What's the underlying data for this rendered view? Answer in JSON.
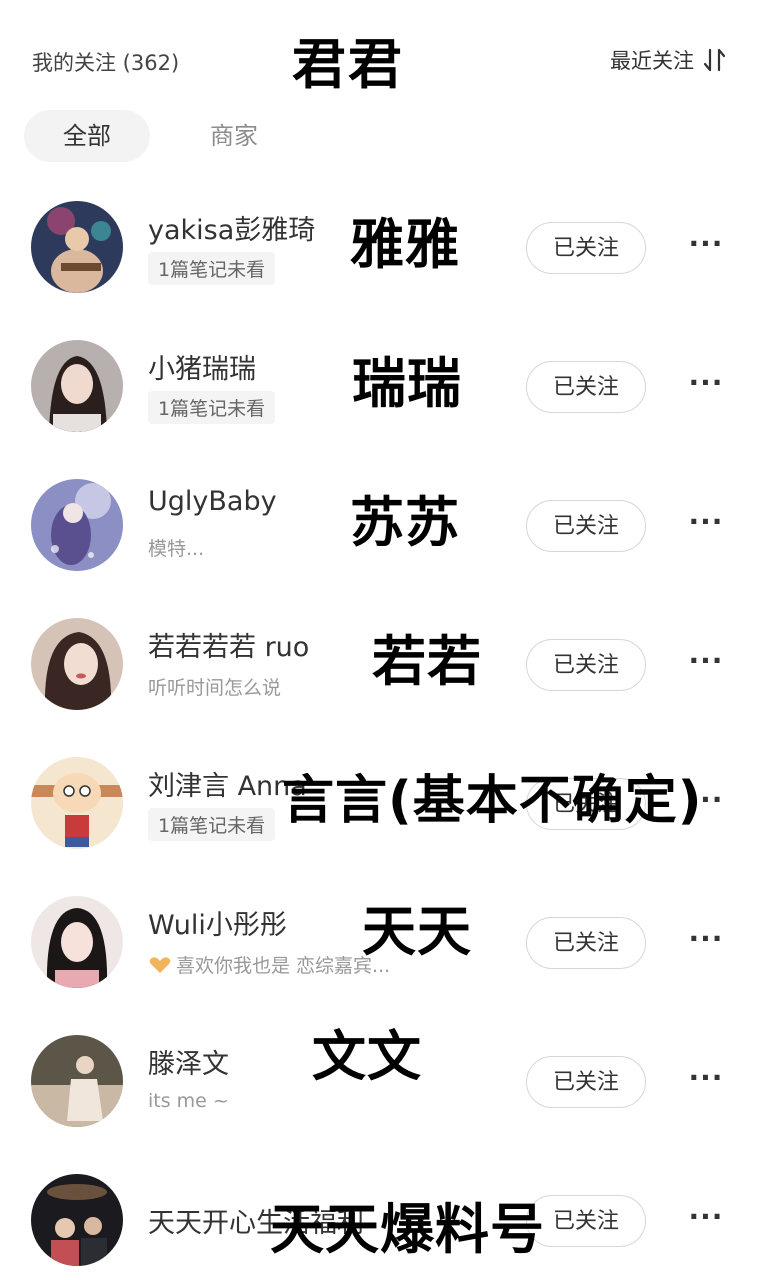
{
  "header": {
    "following_count": "我的关注 (362)",
    "overlay_title": "君君",
    "sort_label": "最近关注",
    "sort_icon": "sort-arrows-icon"
  },
  "tabs": [
    {
      "label": "全部",
      "active": true
    },
    {
      "label": "商家",
      "active": false
    }
  ],
  "accounts": [
    {
      "name": "yakisa彭雅琦",
      "sub": "1篇笔记未看",
      "sub_style": "badge",
      "follow_label": "已关注",
      "more_label": "···",
      "overlay": "雅雅"
    },
    {
      "name": "小猪瑞瑞",
      "sub": "1篇笔记未看",
      "sub_style": "badge",
      "follow_label": "已关注",
      "more_label": "···",
      "overlay": "瑞瑞"
    },
    {
      "name": "UglyBaby",
      "sub": "模特...",
      "sub_style": "plain",
      "follow_label": "已关注",
      "more_label": "···",
      "overlay": "苏苏"
    },
    {
      "name": "若若若若 ruo",
      "sub": "听听时间怎么说",
      "sub_style": "plain",
      "follow_label": "已关注",
      "more_label": "···",
      "overlay": "若若"
    },
    {
      "name": "刘津言 Anna",
      "sub": "1篇笔记未看",
      "sub_style": "badge",
      "follow_label": "已关注",
      "more_label": "···",
      "overlay": "言言(基本不确定)"
    },
    {
      "name": "Wuli小彤彤",
      "sub": "喜欢你我也是 恋综嘉宾...",
      "sub_style": "plain",
      "follow_label": "已关注",
      "more_label": "···",
      "overlay": "天天"
    },
    {
      "name": "滕泽文",
      "sub": "its me ~",
      "sub_style": "plain",
      "follow_label": "已关注",
      "more_label": "···",
      "overlay": "文文"
    },
    {
      "name": "天天开心生活福利",
      "sub": "",
      "sub_style": "plain",
      "follow_label": "已关注",
      "more_label": "···",
      "overlay": "天天爆料号"
    }
  ],
  "colors": {
    "text_primary": "#333333",
    "text_secondary": "#999999",
    "tab_bg": "#f3f3f3",
    "button_border": "#d6d6d6"
  }
}
